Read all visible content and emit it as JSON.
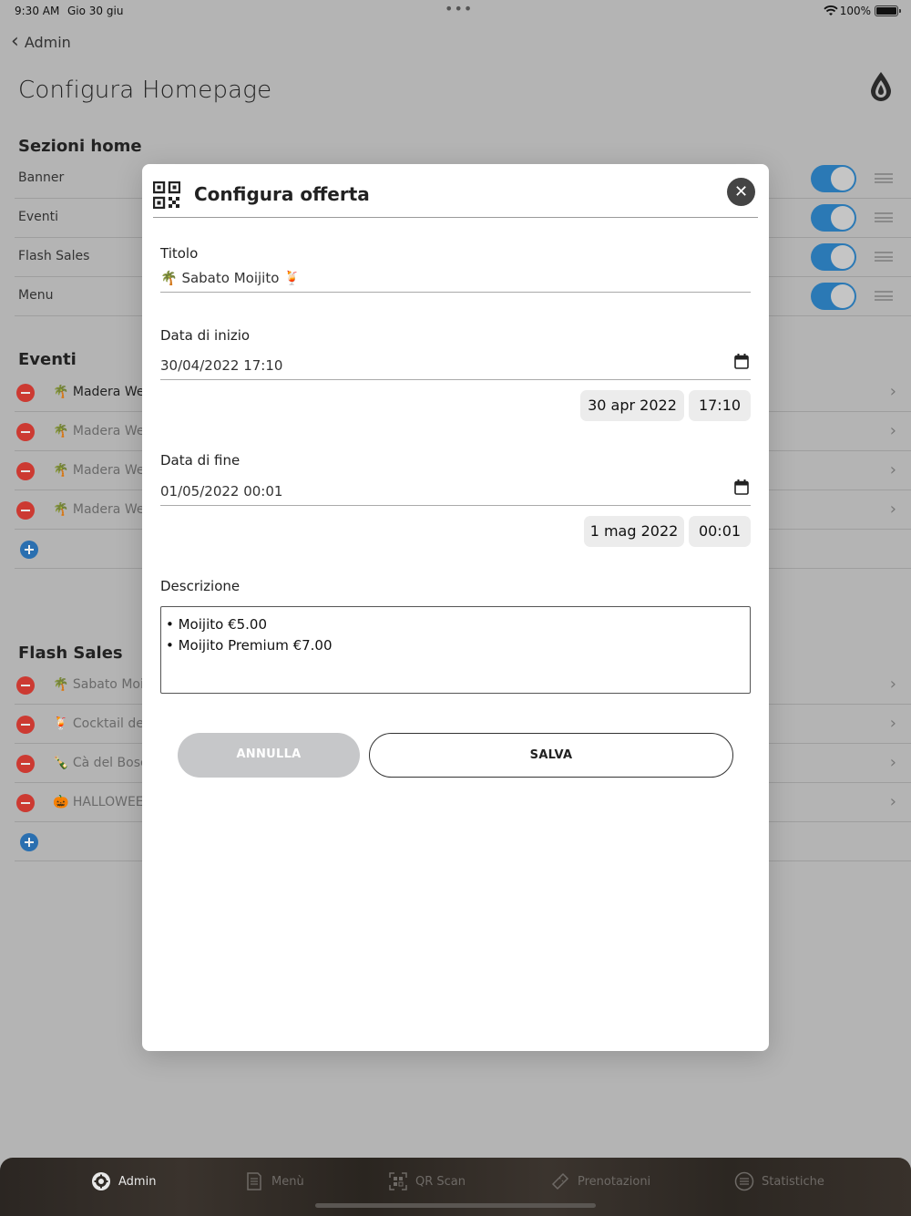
{
  "status_bar": {
    "time": "9:30 AM",
    "date": "Gio 30 giu",
    "dots": "•••",
    "battery": "100%"
  },
  "nav": {
    "back_label": "Admin",
    "title": "Configura Homepage"
  },
  "sections": {
    "home": {
      "title": "Sezioni home",
      "rows": [
        {
          "label": "Banner"
        },
        {
          "label": "Eventi"
        },
        {
          "label": "Flash Sales"
        },
        {
          "label": "Menu"
        }
      ]
    },
    "eventi": {
      "title": "Eventi",
      "items": [
        {
          "text": "🌴 Madera We"
        },
        {
          "text": "🌴 Madera We"
        },
        {
          "text": "🌴 Madera We"
        },
        {
          "text": "🌴 Madera We"
        }
      ]
    },
    "flash": {
      "title": "Flash Sales",
      "items": [
        {
          "text": "🌴 Sabato Moi"
        },
        {
          "text": "🍹 Cocktail de"
        },
        {
          "text": "🍾 Cà del Bosc"
        },
        {
          "text": "🎃 HALLOWEE"
        }
      ]
    }
  },
  "modal": {
    "title": "Configura offerta",
    "titolo_label": "Titolo",
    "titolo_value": "🌴 Sabato Moijito 🍹",
    "start_label": "Data di inizio",
    "start_value": "30/04/2022 17:10",
    "start_date_pill": "30 apr 2022",
    "start_time_pill": "17:10",
    "end_label": "Data di fine",
    "end_value": "01/05/2022 00:01",
    "end_date_pill": "1 mag 2022",
    "end_time_pill": "00:01",
    "desc_label": "Descrizione",
    "desc_lines": [
      "• Moijito €5.00",
      "• Moijito Premium €7.00"
    ],
    "cancel_label": "ANNULLA",
    "save_label": "SALVA"
  },
  "tabbar": {
    "tabs": [
      {
        "label": "Admin",
        "icon": "gear-icon",
        "active": true
      },
      {
        "label": "Menù",
        "icon": "menu-book-icon",
        "active": false
      },
      {
        "label": "QR Scan",
        "icon": "qr-scan-icon",
        "active": false
      },
      {
        "label": "Prenotazioni",
        "icon": "ticket-icon",
        "active": false
      },
      {
        "label": "Statistiche",
        "icon": "list-icon",
        "active": false
      }
    ]
  },
  "colors": {
    "accent_blue": "#2b79b5",
    "delete_red": "#cc3a32",
    "overlay_gray": "#b4b4b4"
  }
}
